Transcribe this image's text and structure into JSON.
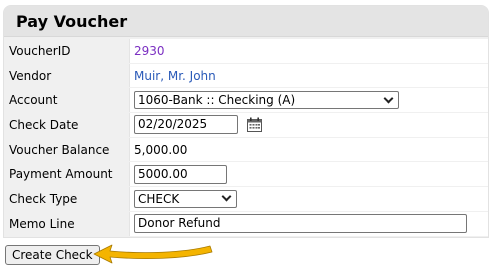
{
  "panel": {
    "title": "Pay Voucher"
  },
  "fields": {
    "voucher_id": {
      "label": "VoucherID",
      "value": "2930"
    },
    "vendor": {
      "label": "Vendor",
      "value": "Muir, Mr. John"
    },
    "account": {
      "label": "Account",
      "value": "1060-Bank :: Checking (A)"
    },
    "check_date": {
      "label": "Check Date",
      "value": "02/20/2025"
    },
    "voucher_balance": {
      "label": "Voucher Balance",
      "value": "5,000.00"
    },
    "payment_amount": {
      "label": "Payment Amount",
      "value": "5000.00"
    },
    "check_type": {
      "label": "Check Type",
      "value": "CHECK"
    },
    "memo_line": {
      "label": "Memo Line",
      "value": "Donor Refund"
    }
  },
  "actions": {
    "create_check_label": "Create Check"
  },
  "colors": {
    "voucher_link": "#7b2fc2",
    "vendor_link": "#2a5ab8",
    "annotation_arrow": "#f4b400"
  },
  "icons": {
    "calendar": "calendar-icon",
    "dropdown": "chevron-down-icon",
    "annotation": "arrow-left-icon"
  }
}
